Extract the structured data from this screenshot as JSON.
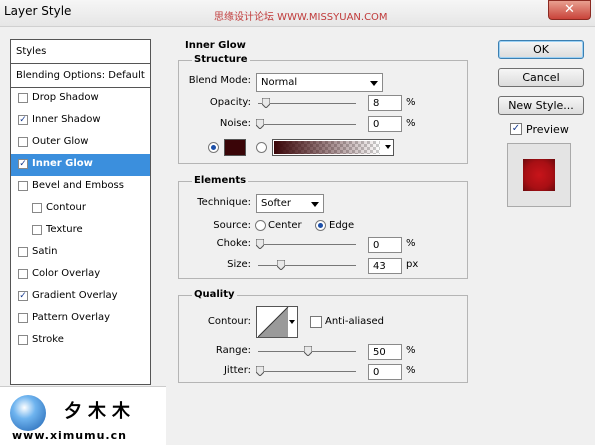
{
  "window": {
    "title": "Layer Style",
    "watermark": "思缘设计论坛 WWW.MISSYUAN.COM",
    "close_glyph": "✕"
  },
  "styles_panel": {
    "header": "Styles",
    "blending": "Blending Options: Default",
    "items": [
      {
        "label": "Drop Shadow",
        "checked": false
      },
      {
        "label": "Inner Shadow",
        "checked": true
      },
      {
        "label": "Outer Glow",
        "checked": false
      },
      {
        "label": "Inner Glow",
        "checked": true,
        "selected": true
      },
      {
        "label": "Bevel and Emboss",
        "checked": false
      },
      {
        "label": "Contour",
        "checked": false,
        "indent": true
      },
      {
        "label": "Texture",
        "checked": false,
        "indent": true
      },
      {
        "label": "Satin",
        "checked": false
      },
      {
        "label": "Color Overlay",
        "checked": false
      },
      {
        "label": "Gradient Overlay",
        "checked": true
      },
      {
        "label": "Pattern Overlay",
        "checked": false
      },
      {
        "label": "Stroke",
        "checked": false
      }
    ]
  },
  "inner_glow": {
    "title": "Inner Glow",
    "structure": {
      "title": "Structure",
      "blend_mode_label": "Blend Mode:",
      "blend_mode": "Normal",
      "opacity_label": "Opacity:",
      "opacity": "8",
      "opacity_unit": "%",
      "noise_label": "Noise:",
      "noise": "0",
      "noise_unit": "%",
      "glow_color": "#3a0508"
    },
    "elements": {
      "title": "Elements",
      "technique_label": "Technique:",
      "technique": "Softer",
      "source_label": "Source:",
      "source_center": "Center",
      "source_edge": "Edge",
      "source_selected": "Edge",
      "choke_label": "Choke:",
      "choke": "0",
      "choke_unit": "%",
      "size_label": "Size:",
      "size": "43",
      "size_unit": "px"
    },
    "quality": {
      "title": "Quality",
      "contour_label": "Contour:",
      "anti_aliased_label": "Anti-aliased",
      "anti_aliased": false,
      "range_label": "Range:",
      "range": "50",
      "range_unit": "%",
      "jitter_label": "Jitter:",
      "jitter": "0",
      "jitter_unit": "%"
    }
  },
  "buttons": {
    "ok": "OK",
    "cancel": "Cancel",
    "new_style": "New Style..."
  },
  "preview": {
    "label": "Preview",
    "checked": true,
    "color": "#c8141a"
  },
  "logo": {
    "chinese": "夕木木",
    "url": "www.ximumu.cn"
  },
  "glyphs": {
    "check": "✓"
  }
}
